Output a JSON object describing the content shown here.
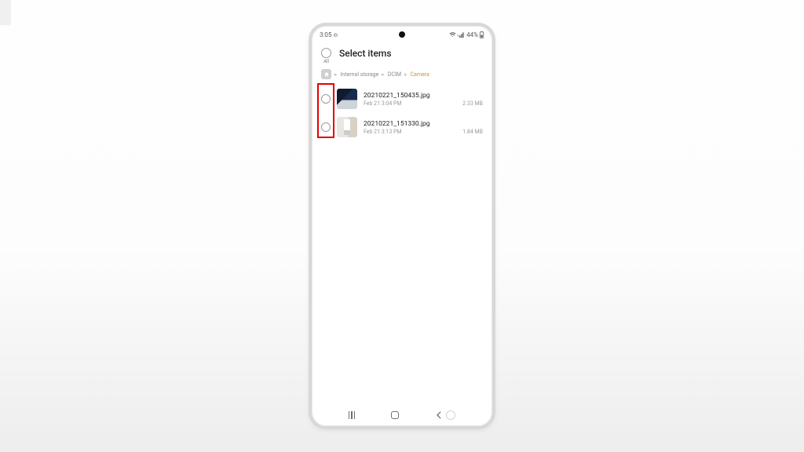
{
  "statusbar": {
    "time": "3:05",
    "battery": "44%"
  },
  "header": {
    "title": "Select items",
    "select_all_label": "All"
  },
  "breadcrumb": {
    "parts": [
      "Internal storage",
      "DCIM"
    ],
    "current": "Camera"
  },
  "files": [
    {
      "name": "20210221_150435.jpg",
      "date": "Feb 21 3:04 PM",
      "size": "2.33 MB"
    },
    {
      "name": "20210221_151330.jpg",
      "date": "Feb 21 3:13 PM",
      "size": "1.84 MB"
    }
  ]
}
